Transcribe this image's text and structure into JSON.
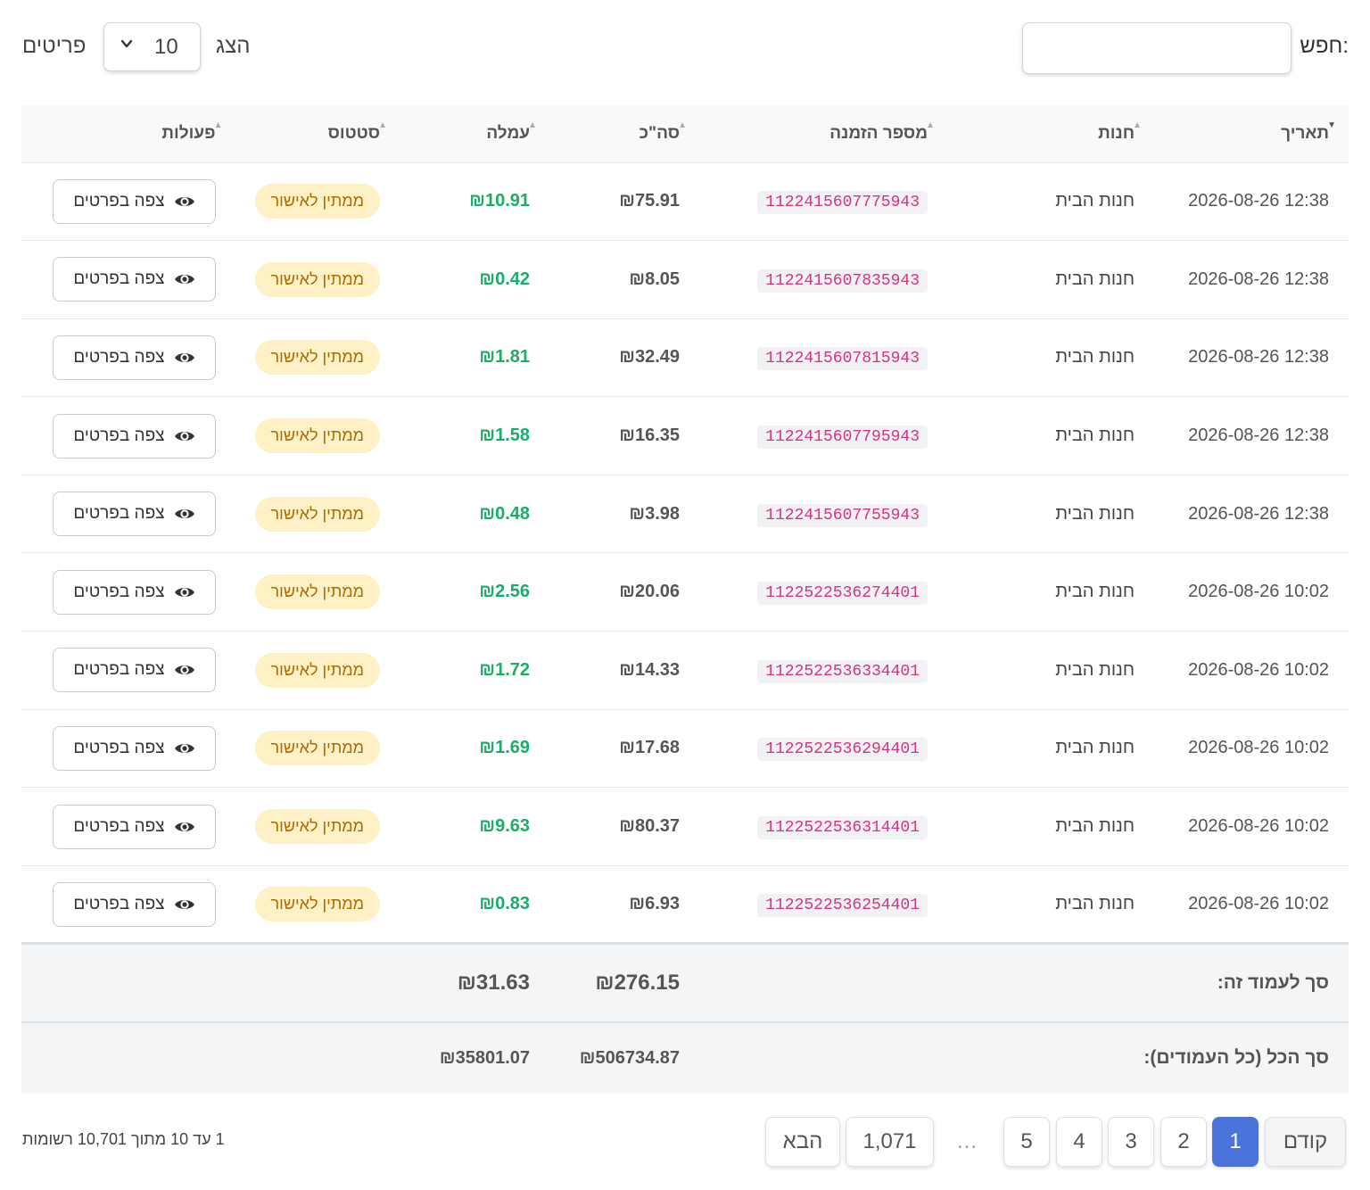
{
  "search": {
    "label": "חפש:",
    "value": "",
    "placeholder": ""
  },
  "page_size": {
    "show_label": "הצג",
    "value": "10",
    "items_label": "פריטים"
  },
  "columns": {
    "date": "תאריך",
    "store": "חנות",
    "order_number": "מספר הזמנה",
    "total": "סה\"כ",
    "commission": "עמלה",
    "status": "סטטוס",
    "actions": "פעולות"
  },
  "rows": [
    {
      "date": "2026-08-26 12:38",
      "store": "חנות הבית",
      "order": "1122415607775943",
      "total": "₪75.91",
      "commission": "₪10.91",
      "status": "ממתין לאישור",
      "action": "צפה בפרטים"
    },
    {
      "date": "2026-08-26 12:38",
      "store": "חנות הבית",
      "order": "1122415607835943",
      "total": "₪8.05",
      "commission": "₪0.42",
      "status": "ממתין לאישור",
      "action": "צפה בפרטים"
    },
    {
      "date": "2026-08-26 12:38",
      "store": "חנות הבית",
      "order": "1122415607815943",
      "total": "₪32.49",
      "commission": "₪1.81",
      "status": "ממתין לאישור",
      "action": "צפה בפרטים"
    },
    {
      "date": "2026-08-26 12:38",
      "store": "חנות הבית",
      "order": "1122415607795943",
      "total": "₪16.35",
      "commission": "₪1.58",
      "status": "ממתין לאישור",
      "action": "צפה בפרטים"
    },
    {
      "date": "2026-08-26 12:38",
      "store": "חנות הבית",
      "order": "1122415607755943",
      "total": "₪3.98",
      "commission": "₪0.48",
      "status": "ממתין לאישור",
      "action": "צפה בפרטים"
    },
    {
      "date": "2026-08-26 10:02",
      "store": "חנות הבית",
      "order": "1122522536274401",
      "total": "₪20.06",
      "commission": "₪2.56",
      "status": "ממתין לאישור",
      "action": "צפה בפרטים"
    },
    {
      "date": "2026-08-26 10:02",
      "store": "חנות הבית",
      "order": "1122522536334401",
      "total": "₪14.33",
      "commission": "₪1.72",
      "status": "ממתין לאישור",
      "action": "צפה בפרטים"
    },
    {
      "date": "2026-08-26 10:02",
      "store": "חנות הבית",
      "order": "1122522536294401",
      "total": "₪17.68",
      "commission": "₪1.69",
      "status": "ממתין לאישור",
      "action": "צפה בפרטים"
    },
    {
      "date": "2026-08-26 10:02",
      "store": "חנות הבית",
      "order": "1122522536314401",
      "total": "₪80.37",
      "commission": "₪9.63",
      "status": "ממתין לאישור",
      "action": "צפה בפרטים"
    },
    {
      "date": "2026-08-26 10:02",
      "store": "חנות הבית",
      "order": "1122522536254401",
      "total": "₪6.93",
      "commission": "₪0.83",
      "status": "ממתין לאישור",
      "action": "צפה בפרטים"
    }
  ],
  "totals": {
    "page_label": "סך לעמוד זה:",
    "page_total": "₪276.15",
    "page_commission": "₪31.63",
    "all_label": "סך הכל (כל העמודים):",
    "all_total": "₪506734.87",
    "all_commission": "₪35801.07"
  },
  "pagination": {
    "prev": "קודם",
    "pages": [
      "1",
      "2",
      "3",
      "4",
      "5"
    ],
    "ellipsis": "…",
    "last": "1,071",
    "next": "הבא",
    "current": "1"
  },
  "records_info": "1 עד 10 מתוך 10,701 רשומות",
  "colors": {
    "accent": "#4a74dc",
    "commission": "#1aad68",
    "order_code": "#d63384",
    "badge_bg": "#fff1c6",
    "badge_text": "#b06a00"
  },
  "icons": {
    "view": "eye-icon",
    "select": "chevron-down-icon",
    "sort": "sort-arrow-icon"
  }
}
